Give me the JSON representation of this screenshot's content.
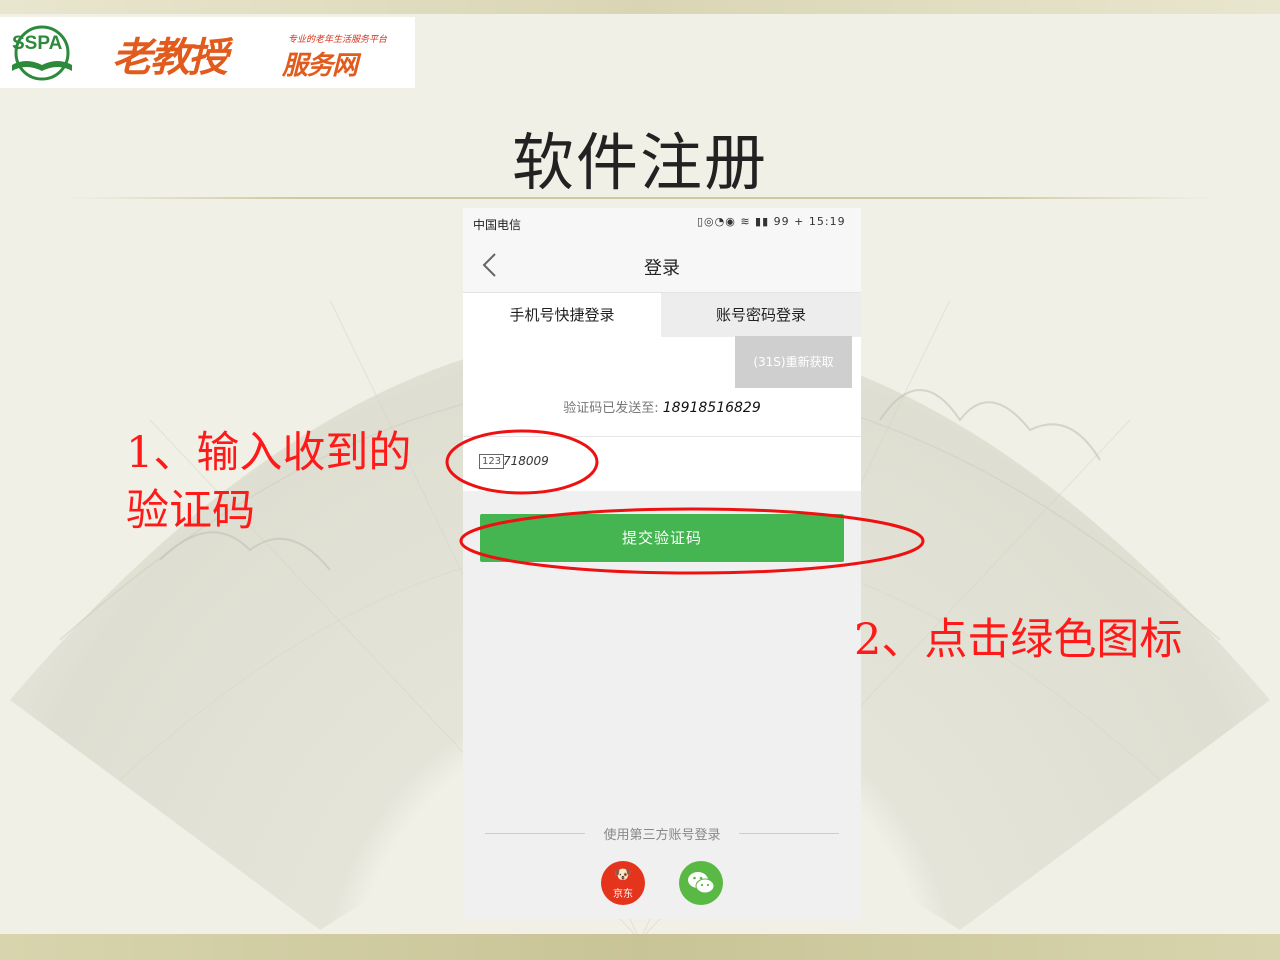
{
  "brand": {
    "emblem_text": "SSPA",
    "name": "老教授",
    "sub": "服务网",
    "tagline": "专业的老年生活服务平台"
  },
  "slide": {
    "title": "软件注册"
  },
  "phone": {
    "status": {
      "carrier": "中国电信",
      "icons": "▯◎◔◉ ≋ ▮▮ 99 + 15:19"
    },
    "nav": {
      "title": "登录"
    },
    "tabs": [
      {
        "label": "手机号快捷登录",
        "active": true
      },
      {
        "label": "账号密码登录",
        "active": false
      }
    ],
    "sent_label": "验证码已发送至:",
    "sent_number": "18918516829",
    "code_icon": "123",
    "code_value": "718009",
    "resend_label": "(31S)重新获取",
    "submit_label": "提交验证码",
    "third_party_label": "使用第三方账号登录",
    "jd_label": "京东",
    "colors": {
      "submit_green": "#44b551",
      "jd_red": "#e4341c",
      "wechat_green": "#5ab944"
    }
  },
  "annotations": {
    "step1": "1、输入收到的验证码",
    "step2": "2、点击绿色图标",
    "color": "#ff1a1a"
  }
}
